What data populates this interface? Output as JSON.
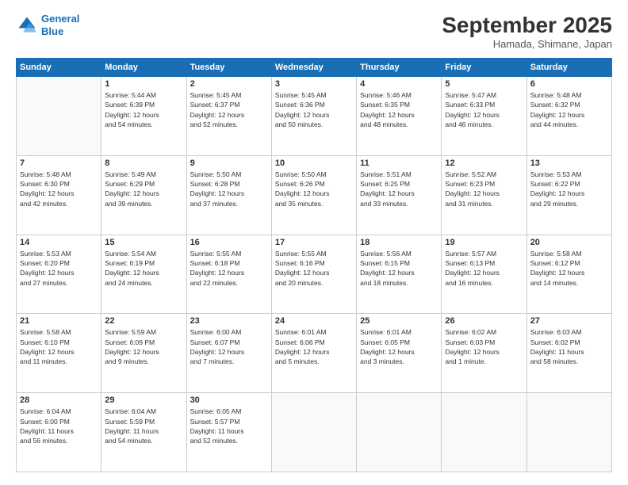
{
  "logo": {
    "line1": "General",
    "line2": "Blue"
  },
  "title": "September 2025",
  "location": "Hamada, Shimane, Japan",
  "days_header": [
    "Sunday",
    "Monday",
    "Tuesday",
    "Wednesday",
    "Thursday",
    "Friday",
    "Saturday"
  ],
  "weeks": [
    [
      {
        "num": "",
        "info": ""
      },
      {
        "num": "1",
        "info": "Sunrise: 5:44 AM\nSunset: 6:39 PM\nDaylight: 12 hours\nand 54 minutes."
      },
      {
        "num": "2",
        "info": "Sunrise: 5:45 AM\nSunset: 6:37 PM\nDaylight: 12 hours\nand 52 minutes."
      },
      {
        "num": "3",
        "info": "Sunrise: 5:45 AM\nSunset: 6:36 PM\nDaylight: 12 hours\nand 50 minutes."
      },
      {
        "num": "4",
        "info": "Sunrise: 5:46 AM\nSunset: 6:35 PM\nDaylight: 12 hours\nand 48 minutes."
      },
      {
        "num": "5",
        "info": "Sunrise: 5:47 AM\nSunset: 6:33 PM\nDaylight: 12 hours\nand 46 minutes."
      },
      {
        "num": "6",
        "info": "Sunrise: 5:48 AM\nSunset: 6:32 PM\nDaylight: 12 hours\nand 44 minutes."
      }
    ],
    [
      {
        "num": "7",
        "info": "Sunrise: 5:48 AM\nSunset: 6:30 PM\nDaylight: 12 hours\nand 42 minutes."
      },
      {
        "num": "8",
        "info": "Sunrise: 5:49 AM\nSunset: 6:29 PM\nDaylight: 12 hours\nand 39 minutes."
      },
      {
        "num": "9",
        "info": "Sunrise: 5:50 AM\nSunset: 6:28 PM\nDaylight: 12 hours\nand 37 minutes."
      },
      {
        "num": "10",
        "info": "Sunrise: 5:50 AM\nSunset: 6:26 PM\nDaylight: 12 hours\nand 35 minutes."
      },
      {
        "num": "11",
        "info": "Sunrise: 5:51 AM\nSunset: 6:25 PM\nDaylight: 12 hours\nand 33 minutes."
      },
      {
        "num": "12",
        "info": "Sunrise: 5:52 AM\nSunset: 6:23 PM\nDaylight: 12 hours\nand 31 minutes."
      },
      {
        "num": "13",
        "info": "Sunrise: 5:53 AM\nSunset: 6:22 PM\nDaylight: 12 hours\nand 29 minutes."
      }
    ],
    [
      {
        "num": "14",
        "info": "Sunrise: 5:53 AM\nSunset: 6:20 PM\nDaylight: 12 hours\nand 27 minutes."
      },
      {
        "num": "15",
        "info": "Sunrise: 5:54 AM\nSunset: 6:19 PM\nDaylight: 12 hours\nand 24 minutes."
      },
      {
        "num": "16",
        "info": "Sunrise: 5:55 AM\nSunset: 6:18 PM\nDaylight: 12 hours\nand 22 minutes."
      },
      {
        "num": "17",
        "info": "Sunrise: 5:55 AM\nSunset: 6:16 PM\nDaylight: 12 hours\nand 20 minutes."
      },
      {
        "num": "18",
        "info": "Sunrise: 5:56 AM\nSunset: 6:15 PM\nDaylight: 12 hours\nand 18 minutes."
      },
      {
        "num": "19",
        "info": "Sunrise: 5:57 AM\nSunset: 6:13 PM\nDaylight: 12 hours\nand 16 minutes."
      },
      {
        "num": "20",
        "info": "Sunrise: 5:58 AM\nSunset: 6:12 PM\nDaylight: 12 hours\nand 14 minutes."
      }
    ],
    [
      {
        "num": "21",
        "info": "Sunrise: 5:58 AM\nSunset: 6:10 PM\nDaylight: 12 hours\nand 11 minutes."
      },
      {
        "num": "22",
        "info": "Sunrise: 5:59 AM\nSunset: 6:09 PM\nDaylight: 12 hours\nand 9 minutes."
      },
      {
        "num": "23",
        "info": "Sunrise: 6:00 AM\nSunset: 6:07 PM\nDaylight: 12 hours\nand 7 minutes."
      },
      {
        "num": "24",
        "info": "Sunrise: 6:01 AM\nSunset: 6:06 PM\nDaylight: 12 hours\nand 5 minutes."
      },
      {
        "num": "25",
        "info": "Sunrise: 6:01 AM\nSunset: 6:05 PM\nDaylight: 12 hours\nand 3 minutes."
      },
      {
        "num": "26",
        "info": "Sunrise: 6:02 AM\nSunset: 6:03 PM\nDaylight: 12 hours\nand 1 minute."
      },
      {
        "num": "27",
        "info": "Sunrise: 6:03 AM\nSunset: 6:02 PM\nDaylight: 11 hours\nand 58 minutes."
      }
    ],
    [
      {
        "num": "28",
        "info": "Sunrise: 6:04 AM\nSunset: 6:00 PM\nDaylight: 11 hours\nand 56 minutes."
      },
      {
        "num": "29",
        "info": "Sunrise: 6:04 AM\nSunset: 5:59 PM\nDaylight: 11 hours\nand 54 minutes."
      },
      {
        "num": "30",
        "info": "Sunrise: 6:05 AM\nSunset: 5:57 PM\nDaylight: 11 hours\nand 52 minutes."
      },
      {
        "num": "",
        "info": ""
      },
      {
        "num": "",
        "info": ""
      },
      {
        "num": "",
        "info": ""
      },
      {
        "num": "",
        "info": ""
      }
    ]
  ]
}
